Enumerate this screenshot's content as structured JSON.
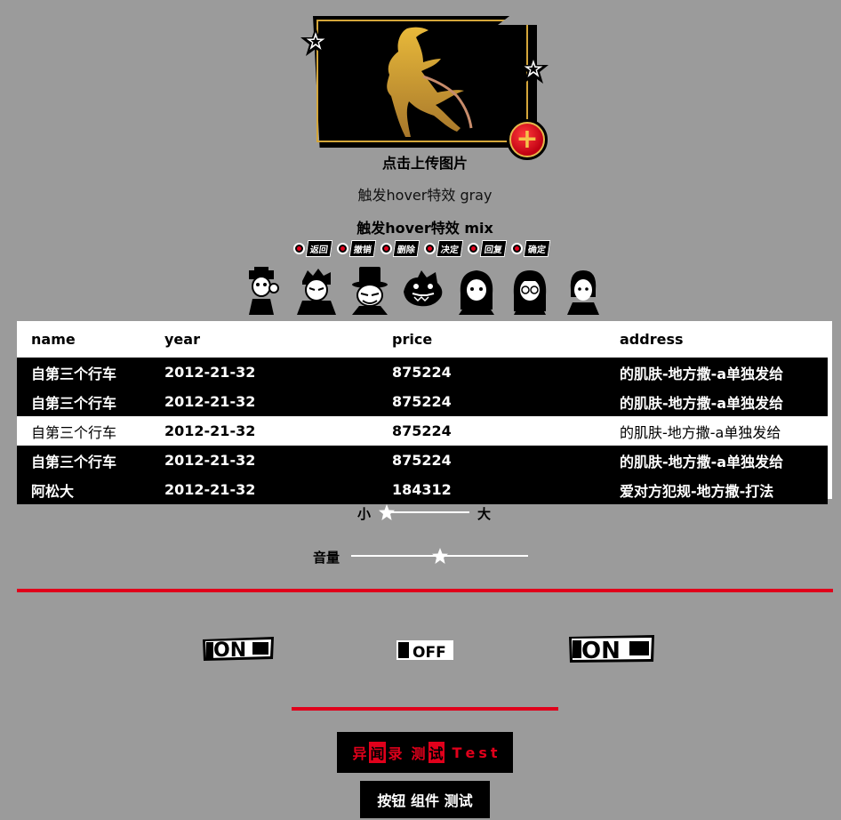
{
  "upload": {
    "label": "点击上传图片",
    "accent": "#d4a63a",
    "icons": [
      "phantom-thief-figure-icon",
      "star-icon",
      "plus-icon"
    ]
  },
  "hover": {
    "gray_label": "触发hover特效 gray",
    "mix_label": "触发hover特效 mix"
  },
  "chips": [
    {
      "label": "返回"
    },
    {
      "label": "撤销"
    },
    {
      "label": "删除"
    },
    {
      "label": "决定"
    },
    {
      "label": "回复"
    },
    {
      "label": "确定"
    }
  ],
  "avatars": [
    {
      "name": "avatar-1"
    },
    {
      "name": "avatar-2"
    },
    {
      "name": "avatar-3"
    },
    {
      "name": "avatar-4"
    },
    {
      "name": "avatar-5"
    },
    {
      "name": "avatar-6"
    },
    {
      "name": "avatar-7"
    }
  ],
  "table": {
    "columns": [
      "name",
      "year",
      "price",
      "address"
    ],
    "rows": [
      {
        "name": "自第三个行车",
        "year": "2012-21-32",
        "price": "875224",
        "address": "的肌肤-地方撒-a单独发给",
        "style": "dark"
      },
      {
        "name": "自第三个行车",
        "year": "2012-21-32",
        "price": "875224",
        "address": "的肌肤-地方撒-a单独发给",
        "style": "dark"
      },
      {
        "name": "自第三个行车",
        "year": "2012-21-32",
        "price": "875224",
        "address": "的肌肤-地方撒-a单独发给",
        "style": "light"
      },
      {
        "name": "自第三个行车",
        "year": "2012-21-32",
        "price": "875224",
        "address": "的肌肤-地方撒-a单独发给",
        "style": "dark"
      },
      {
        "name": "阿松大",
        "year": "2012-21-32",
        "price": "184312",
        "address": "爱对方犯规-地方撒-打法",
        "style": "dark"
      }
    ]
  },
  "size_slider": {
    "min_label": "小",
    "max_label": "大",
    "value": 0.05
  },
  "volume_slider": {
    "label": "音量",
    "value": 0.5
  },
  "toggles": [
    {
      "label": "ON",
      "state": "on"
    },
    {
      "label": "OFF",
      "state": "off"
    },
    {
      "label": "ON",
      "state": "on"
    }
  ],
  "buttons": {
    "phantom_chars": [
      "异",
      "闻",
      "录",
      "测",
      "试",
      "T",
      "e",
      "s",
      "t"
    ],
    "plain_label": "按钮 组件 测试"
  },
  "colors": {
    "background": "#9b9b9b",
    "accent_red": "#e0001b",
    "gold": "#d4a63a"
  }
}
